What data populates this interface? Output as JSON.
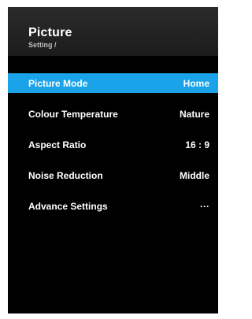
{
  "header": {
    "title": "Picture",
    "breadcrumb": "Setting /"
  },
  "menu": {
    "items": [
      {
        "label": "Picture Mode",
        "value": "Home",
        "selected": true
      },
      {
        "label": "Colour Temperature",
        "value": "Nature",
        "selected": false
      },
      {
        "label": "Aspect Ratio",
        "value": "16 : 9",
        "selected": false
      },
      {
        "label": "Noise Reduction",
        "value": "Middle",
        "selected": false
      },
      {
        "label": "Advance Settings",
        "value": "···",
        "selected": false
      }
    ]
  },
  "colors": {
    "highlight": "#1aa3e8",
    "background": "#000000",
    "header": "#262626"
  }
}
